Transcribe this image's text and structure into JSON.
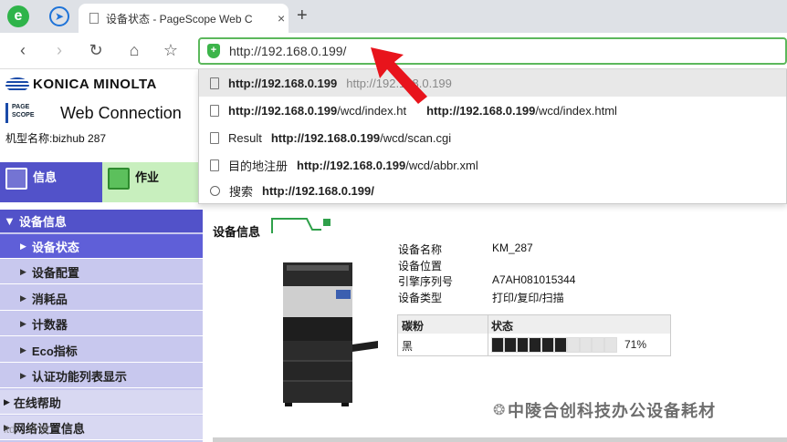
{
  "browser": {
    "tab_title": "设备状态 - PageScope Web C",
    "tab_close": "×",
    "new_tab": "+",
    "address": "http://192.168.0.199/",
    "suggestions": [
      {
        "icon": "page-icon",
        "bold": "http://192.168.0.199",
        "rest": "http://192.168.0.199",
        "active": true
      },
      {
        "icon": "page-icon",
        "bold": "http://192.168.0.199",
        "rest": "/wcd/index.ht",
        "bold2": "http://192.168.0.199",
        "rest2": "/wcd/index.html"
      },
      {
        "icon": "page-icon",
        "prefix": "Result",
        "bold": "http://192.168.0.199",
        "rest": "/wcd/scan.cgi"
      },
      {
        "icon": "page-icon",
        "prefix": "目的地注册",
        "bold": "http://192.168.0.199",
        "rest": "/wcd/abbr.xml"
      },
      {
        "icon": "search-icon",
        "prefix": "搜索",
        "bold": "http://192.168.0.199/",
        "rest": ""
      }
    ]
  },
  "header": {
    "brand": "KONICA MINOLTA",
    "ps_line1": "PAGE",
    "ps_line2": "SCOPE",
    "app_name": "Web Connection",
    "model": "机型名称:bizhub 287"
  },
  "tabs": {
    "info": "信息",
    "job": "作业"
  },
  "nav": {
    "section_device": "设备信息",
    "items": [
      {
        "label": "设备状态",
        "active": true
      },
      {
        "label": "设备配置"
      },
      {
        "label": "消耗品"
      },
      {
        "label": "计数器"
      },
      {
        "label": "Eco指标"
      },
      {
        "label": "认证功能列表显示"
      }
    ],
    "help": "在线帮助",
    "network": "网络设置信息"
  },
  "main": {
    "title": "设备信息",
    "fields": [
      {
        "label": "设备名称",
        "value": "KM_287"
      },
      {
        "label": "设备位置",
        "value": ""
      },
      {
        "label": "引擎序列号",
        "value": "A7AH081015344"
      },
      {
        "label": "设备类型",
        "value": "打印/复印/扫描"
      }
    ],
    "toner_header_color": "碳粉",
    "toner_header_status": "状态",
    "toner_color": "黑",
    "toner_level_percent": 71,
    "toner_pct_label": "71%"
  },
  "watermark": "中陵合创科技办公设备耗材",
  "corner_watermark": "itd... 环境",
  "colors": {
    "nav_blue": "#5252c9",
    "nav_light": "#c8c8ee",
    "job_green": "#c8efbe",
    "address_border": "#5cb85c",
    "arrow_red": "#e8141c"
  }
}
